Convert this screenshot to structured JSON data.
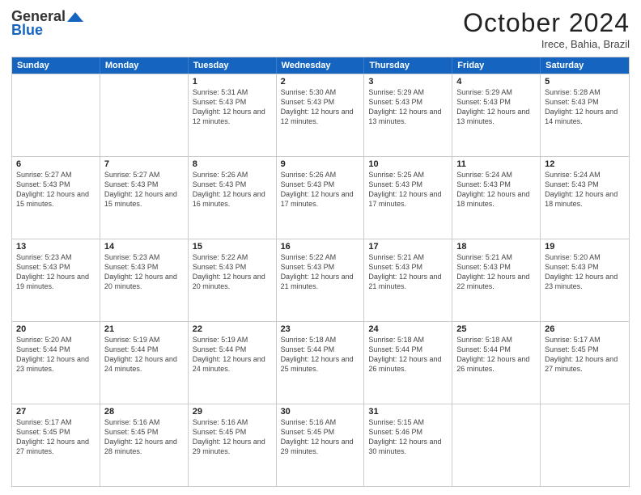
{
  "header": {
    "logo_general": "General",
    "logo_blue": "Blue",
    "month_title": "October 2024",
    "location": "Irece, Bahia, Brazil"
  },
  "days_of_week": [
    "Sunday",
    "Monday",
    "Tuesday",
    "Wednesday",
    "Thursday",
    "Friday",
    "Saturday"
  ],
  "weeks": [
    [
      {
        "day": "",
        "sunrise": "",
        "sunset": "",
        "daylight": ""
      },
      {
        "day": "",
        "sunrise": "",
        "sunset": "",
        "daylight": ""
      },
      {
        "day": "1",
        "sunrise": "Sunrise: 5:31 AM",
        "sunset": "Sunset: 5:43 PM",
        "daylight": "Daylight: 12 hours and 12 minutes."
      },
      {
        "day": "2",
        "sunrise": "Sunrise: 5:30 AM",
        "sunset": "Sunset: 5:43 PM",
        "daylight": "Daylight: 12 hours and 12 minutes."
      },
      {
        "day": "3",
        "sunrise": "Sunrise: 5:29 AM",
        "sunset": "Sunset: 5:43 PM",
        "daylight": "Daylight: 12 hours and 13 minutes."
      },
      {
        "day": "4",
        "sunrise": "Sunrise: 5:29 AM",
        "sunset": "Sunset: 5:43 PM",
        "daylight": "Daylight: 12 hours and 13 minutes."
      },
      {
        "day": "5",
        "sunrise": "Sunrise: 5:28 AM",
        "sunset": "Sunset: 5:43 PM",
        "daylight": "Daylight: 12 hours and 14 minutes."
      }
    ],
    [
      {
        "day": "6",
        "sunrise": "Sunrise: 5:27 AM",
        "sunset": "Sunset: 5:43 PM",
        "daylight": "Daylight: 12 hours and 15 minutes."
      },
      {
        "day": "7",
        "sunrise": "Sunrise: 5:27 AM",
        "sunset": "Sunset: 5:43 PM",
        "daylight": "Daylight: 12 hours and 15 minutes."
      },
      {
        "day": "8",
        "sunrise": "Sunrise: 5:26 AM",
        "sunset": "Sunset: 5:43 PM",
        "daylight": "Daylight: 12 hours and 16 minutes."
      },
      {
        "day": "9",
        "sunrise": "Sunrise: 5:26 AM",
        "sunset": "Sunset: 5:43 PM",
        "daylight": "Daylight: 12 hours and 17 minutes."
      },
      {
        "day": "10",
        "sunrise": "Sunrise: 5:25 AM",
        "sunset": "Sunset: 5:43 PM",
        "daylight": "Daylight: 12 hours and 17 minutes."
      },
      {
        "day": "11",
        "sunrise": "Sunrise: 5:24 AM",
        "sunset": "Sunset: 5:43 PM",
        "daylight": "Daylight: 12 hours and 18 minutes."
      },
      {
        "day": "12",
        "sunrise": "Sunrise: 5:24 AM",
        "sunset": "Sunset: 5:43 PM",
        "daylight": "Daylight: 12 hours and 18 minutes."
      }
    ],
    [
      {
        "day": "13",
        "sunrise": "Sunrise: 5:23 AM",
        "sunset": "Sunset: 5:43 PM",
        "daylight": "Daylight: 12 hours and 19 minutes."
      },
      {
        "day": "14",
        "sunrise": "Sunrise: 5:23 AM",
        "sunset": "Sunset: 5:43 PM",
        "daylight": "Daylight: 12 hours and 20 minutes."
      },
      {
        "day": "15",
        "sunrise": "Sunrise: 5:22 AM",
        "sunset": "Sunset: 5:43 PM",
        "daylight": "Daylight: 12 hours and 20 minutes."
      },
      {
        "day": "16",
        "sunrise": "Sunrise: 5:22 AM",
        "sunset": "Sunset: 5:43 PM",
        "daylight": "Daylight: 12 hours and 21 minutes."
      },
      {
        "day": "17",
        "sunrise": "Sunrise: 5:21 AM",
        "sunset": "Sunset: 5:43 PM",
        "daylight": "Daylight: 12 hours and 21 minutes."
      },
      {
        "day": "18",
        "sunrise": "Sunrise: 5:21 AM",
        "sunset": "Sunset: 5:43 PM",
        "daylight": "Daylight: 12 hours and 22 minutes."
      },
      {
        "day": "19",
        "sunrise": "Sunrise: 5:20 AM",
        "sunset": "Sunset: 5:43 PM",
        "daylight": "Daylight: 12 hours and 23 minutes."
      }
    ],
    [
      {
        "day": "20",
        "sunrise": "Sunrise: 5:20 AM",
        "sunset": "Sunset: 5:44 PM",
        "daylight": "Daylight: 12 hours and 23 minutes."
      },
      {
        "day": "21",
        "sunrise": "Sunrise: 5:19 AM",
        "sunset": "Sunset: 5:44 PM",
        "daylight": "Daylight: 12 hours and 24 minutes."
      },
      {
        "day": "22",
        "sunrise": "Sunrise: 5:19 AM",
        "sunset": "Sunset: 5:44 PM",
        "daylight": "Daylight: 12 hours and 24 minutes."
      },
      {
        "day": "23",
        "sunrise": "Sunrise: 5:18 AM",
        "sunset": "Sunset: 5:44 PM",
        "daylight": "Daylight: 12 hours and 25 minutes."
      },
      {
        "day": "24",
        "sunrise": "Sunrise: 5:18 AM",
        "sunset": "Sunset: 5:44 PM",
        "daylight": "Daylight: 12 hours and 26 minutes."
      },
      {
        "day": "25",
        "sunrise": "Sunrise: 5:18 AM",
        "sunset": "Sunset: 5:44 PM",
        "daylight": "Daylight: 12 hours and 26 minutes."
      },
      {
        "day": "26",
        "sunrise": "Sunrise: 5:17 AM",
        "sunset": "Sunset: 5:45 PM",
        "daylight": "Daylight: 12 hours and 27 minutes."
      }
    ],
    [
      {
        "day": "27",
        "sunrise": "Sunrise: 5:17 AM",
        "sunset": "Sunset: 5:45 PM",
        "daylight": "Daylight: 12 hours and 27 minutes."
      },
      {
        "day": "28",
        "sunrise": "Sunrise: 5:16 AM",
        "sunset": "Sunset: 5:45 PM",
        "daylight": "Daylight: 12 hours and 28 minutes."
      },
      {
        "day": "29",
        "sunrise": "Sunrise: 5:16 AM",
        "sunset": "Sunset: 5:45 PM",
        "daylight": "Daylight: 12 hours and 29 minutes."
      },
      {
        "day": "30",
        "sunrise": "Sunrise: 5:16 AM",
        "sunset": "Sunset: 5:45 PM",
        "daylight": "Daylight: 12 hours and 29 minutes."
      },
      {
        "day": "31",
        "sunrise": "Sunrise: 5:15 AM",
        "sunset": "Sunset: 5:46 PM",
        "daylight": "Daylight: 12 hours and 30 minutes."
      },
      {
        "day": "",
        "sunrise": "",
        "sunset": "",
        "daylight": ""
      },
      {
        "day": "",
        "sunrise": "",
        "sunset": "",
        "daylight": ""
      }
    ]
  ]
}
